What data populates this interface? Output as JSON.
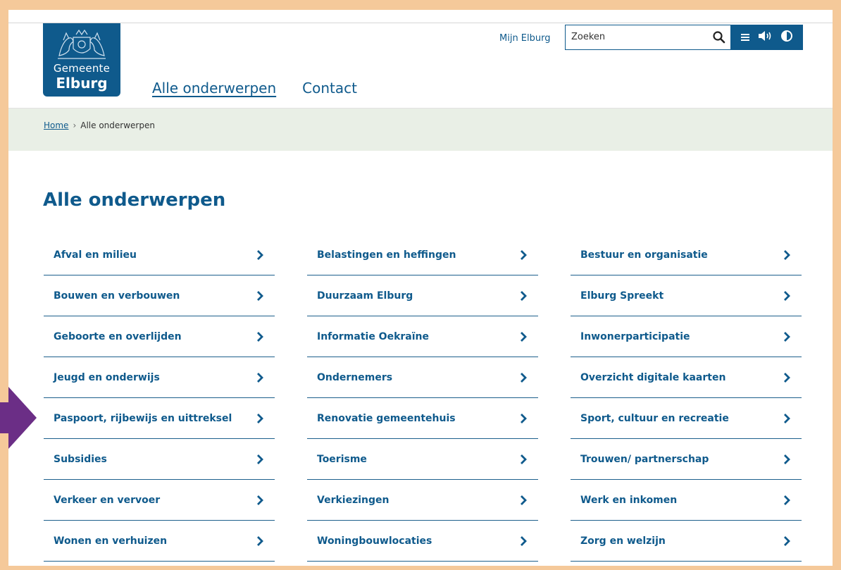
{
  "header": {
    "logo": {
      "line1": "Gemeente",
      "line2": "Elburg"
    },
    "mijn_link": "Mijn Elburg",
    "search": {
      "placeholder": "Zoeken"
    },
    "nav": [
      {
        "label": "Alle onderwerpen",
        "active": true
      },
      {
        "label": "Contact",
        "active": false
      }
    ],
    "tools": [
      "menu-icon",
      "speaker-icon",
      "contrast-icon"
    ]
  },
  "breadcrumb": {
    "home": "Home",
    "separator": "›",
    "current": "Alle onderwerpen"
  },
  "page_title": "Alle onderwerpen",
  "topics": [
    "Afval en milieu",
    "Belastingen en heffingen",
    "Bestuur en organisatie",
    "Bouwen en verbouwen",
    "Duurzaam Elburg",
    "Elburg Spreekt",
    "Geboorte en overlijden",
    "Informatie Oekraïne",
    "Inwonerparticipatie",
    "Jeugd en onderwijs",
    "Ondernemers",
    "Overzicht digitale kaarten",
    "Paspoort, rijbewijs en uittreksel",
    "Renovatie gemeentehuis",
    "Sport, cultuur en recreatie",
    "Subsidies",
    "Toerisme",
    "Trouwen/ partnerschap",
    "Verkeer en vervoer",
    "Verkiezingen",
    "Werk en inkomen",
    "Wonen en verhuizen",
    "Woningbouwlocaties",
    "Zorg en welzijn"
  ],
  "colors": {
    "brand": "#0f5a8c",
    "crumb_bg": "#e9efe6",
    "frame": "#f5c99a",
    "pointer": "#6b2e86"
  }
}
